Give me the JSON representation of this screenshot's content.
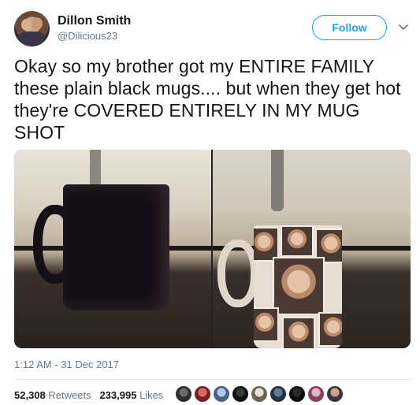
{
  "author": {
    "name": "Dillon Smith",
    "handle": "@Dilicious23"
  },
  "follow_label": "Follow",
  "tweet": {
    "text": "Okay so my brother got my ENTIRE FAMILY these plain black mugs.... but when they get hot they're COVERED ENTIRELY IN MY MUG SHOT"
  },
  "timestamp": "1:12 AM - 31 Dec 2017",
  "stats": {
    "retweets_count": "52,308",
    "retweets_label": "Retweets",
    "likes_count": "233,995",
    "likes_label": "Likes"
  },
  "likers": [
    "liker-1",
    "liker-2",
    "liker-3",
    "liker-4",
    "liker-5",
    "liker-6",
    "liker-7",
    "liker-8",
    "liker-9"
  ],
  "colors": {
    "accent": "#1da1f2",
    "secondary_text": "#657786",
    "primary_text": "#14171a"
  }
}
